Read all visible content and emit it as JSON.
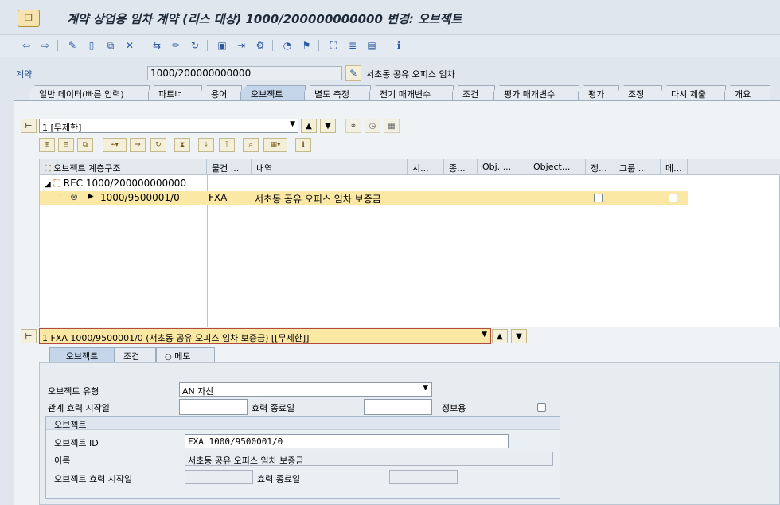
{
  "window": {
    "title": "계약 상업용 임차 계약 (리스 대상) 1000/200000000000 변경: 오브젝트"
  },
  "header": {
    "contract_label": "계약",
    "contract_value": "1000/200000000000",
    "contract_desc": "서초동 공유 오피스 임차"
  },
  "tabs": [
    {
      "label": "일반 데이터(빠른 입력)"
    },
    {
      "label": "파트너"
    },
    {
      "label": "용어"
    },
    {
      "label": "오브젝트"
    },
    {
      "label": "별도 측정"
    },
    {
      "label": "전기 매개변수"
    },
    {
      "label": "조건"
    },
    {
      "label": "평가 매개변수"
    },
    {
      "label": "평가"
    },
    {
      "label": "조정"
    },
    {
      "label": "다시 제출"
    },
    {
      "label": "개요"
    }
  ],
  "selector": {
    "value": "1 [무제한]"
  },
  "grid": {
    "columns": [
      "오브젝트 계층구조",
      "물건 ...",
      "내역",
      "시...",
      "종...",
      "Obj. ...",
      "Object...",
      "정...",
      "그룹 ...",
      "메..."
    ],
    "root": "REC 1000/200000000000",
    "row": {
      "node": "1000/9500001/0",
      "type": "FXA",
      "desc": "서초동 공유 오피스 임차 보증금"
    }
  },
  "object_selector": {
    "value": "1 FXA 1000/9500001/0 (서초동 공유 오피스 임차 보증금) [[무제한]]"
  },
  "subtabs": [
    {
      "label": "오브젝트"
    },
    {
      "label": "조건"
    },
    {
      "label": "메모"
    }
  ],
  "form": {
    "object_type_label": "오브젝트 유형",
    "object_type_value": "AN 자산",
    "rel_start_label": "관계 효력 시작일",
    "rel_end_label": "효력 종료일",
    "info_label": "정보용",
    "group_title": "오브젝트",
    "object_id_label": "오브젝트 ID",
    "object_id_value": "FXA 1000/9500001/0",
    "name_label": "이름",
    "name_value": "서초동 공유 오피스 임차 보증금",
    "obj_start_label": "오브젝트 효력 시작일",
    "obj_end_label": "효력 종료일"
  }
}
